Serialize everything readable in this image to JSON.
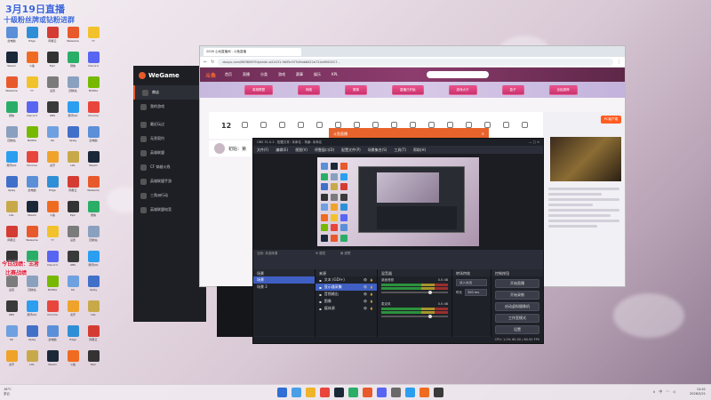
{
  "overlay": {
    "line1": "3月19日直播",
    "line2": "十级粉丝牌或钻粉进群",
    "side1": "今日战绩：王者",
    "side2": "比赛战绩"
  },
  "desktop_icons": [
    {
      "label": "此电脑",
      "color": "#5b8fd8"
    },
    {
      "label": "Steam",
      "color": "#1b2838"
    },
    {
      "label": "WeGame",
      "color": "#e8592b"
    },
    {
      "label": "微信",
      "color": "#2aae67"
    },
    {
      "label": "回收站",
      "color": "#8aa0bf"
    },
    {
      "label": "腾讯QQ",
      "color": "#2b9ef0"
    },
    {
      "label": "Uplay",
      "color": "#4170c9"
    },
    {
      "label": "LOL",
      "color": "#c8a94a"
    },
    {
      "label": "网易云",
      "color": "#d43c33"
    },
    {
      "label": "Epic",
      "color": "#333"
    },
    {
      "label": "设置",
      "color": "#7b7b7b"
    },
    {
      "label": "OBS",
      "color": "#3a3a3a"
    },
    {
      "label": "KK",
      "color": "#6fa0e0"
    },
    {
      "label": "虎牙",
      "color": "#f0a32a"
    },
    {
      "label": "Edge",
      "color": "#2f8fd6"
    },
    {
      "label": "斗鱼",
      "color": "#f06b22"
    },
    {
      "label": "YY",
      "color": "#f2c22c"
    },
    {
      "label": "Discord",
      "color": "#5865f2"
    },
    {
      "label": "NVIDIA",
      "color": "#76b900"
    },
    {
      "label": "Chrome",
      "color": "#e8453c"
    }
  ],
  "wegame": {
    "brand": "WeGame",
    "items": [
      "商店",
      "我的游戏",
      "最近玩过",
      "无畏契约",
      "英雄联盟",
      "CF 穿越火线",
      "英雄联盟手游",
      "三角洲行动",
      "英雄联盟电竞"
    ]
  },
  "browser": {
    "tab_title": "2026 心动直播间 - 斗鱼直播",
    "url": "douyu.com/9636059?dyshid=a22431-9b55c97549ab6422e722a9000017...",
    "nav": [
      "首页",
      "直播",
      "分类",
      "游戏",
      "赛事",
      "娱乐",
      "KPL"
    ],
    "logo": "斗鱼",
    "banner_pills": [
      "英雄联盟",
      "网络",
      "赛事",
      "直播已开始",
      "游戏大厅",
      "盒子",
      "全民超神"
    ],
    "category_count": "12",
    "room_title": "初始：第",
    "pc_button": "PC客户端"
  },
  "obs": {
    "title": "OBS 31.0.2 - 配置文件: 未命名 - 场景: 未命名",
    "menu": [
      "文件(F)",
      "编辑(E)",
      "视图(V)",
      "停靠窗口(D)",
      "配置文件(P)",
      "场景集合(S)",
      "工具(T)",
      "帮助(H)"
    ],
    "source_bar": "当前: 未选择源",
    "props_label": "属性",
    "filter_label": "滤镜",
    "scenes_header": "场景",
    "scenes": [
      "场景",
      "场景 2"
    ],
    "sources_header": "来源",
    "sources": [
      "文本 (GDI+)",
      "显示器采集",
      "音频输出",
      "图像",
      "媒体源"
    ],
    "mixer_header": "混音器",
    "mixer": [
      {
        "name": "桌面音频",
        "db": "0.0 dB"
      },
      {
        "name": "麦克风",
        "db": "0.0 dB"
      }
    ],
    "transition_header": "转场特效",
    "transition_type": "淡入淡出",
    "duration_label": "时长",
    "duration_value": "300 ms",
    "controls_header": "控制按钮",
    "controls": [
      "开始直播",
      "开始录制",
      "启动虚拟摄像机",
      "工作室模式",
      "设置",
      "退出"
    ],
    "status": "CPU: 1.0%   60.00 / 60.00 FPS"
  },
  "popup": {
    "title": "斗鱼直播",
    "close": "✕"
  },
  "taskbar": {
    "weather_temp": "16°C",
    "weather_desc": "多云",
    "time": "14:41",
    "date": "2026/3/21",
    "tray_lang": "中"
  }
}
